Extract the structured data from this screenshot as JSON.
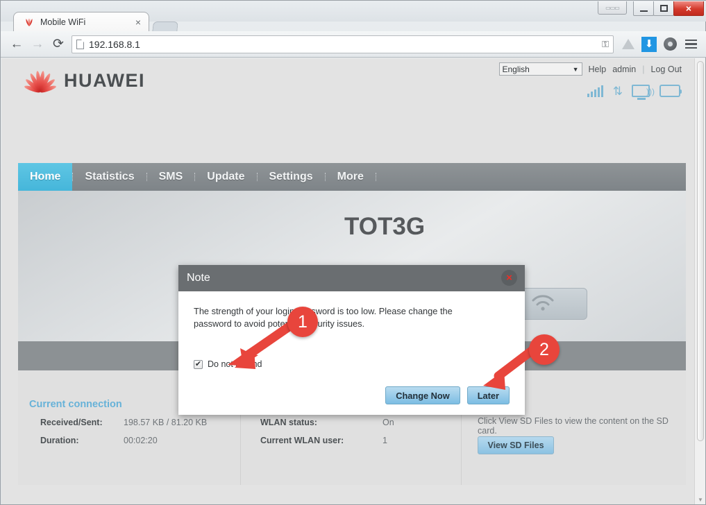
{
  "browser": {
    "window_controls": {
      "restore_tabs": "restore-tabs-icon",
      "minimize": "minimize-icon",
      "maximize": "maximize-icon",
      "close": "×"
    },
    "tab": {
      "title": "Mobile WiFi",
      "favicon": "huawei-favicon",
      "close": "×"
    },
    "toolbar": {
      "back": "←",
      "forward": "→",
      "reload": "⟳",
      "url": "192.168.8.1",
      "omnibox_key_icon": "key-icon",
      "extensions": [
        "drive-icon",
        "download-icon",
        "film-reel-icon"
      ],
      "menu": "hamburger-menu-icon"
    },
    "scrollbar": {
      "down_arrow": "▼"
    }
  },
  "header": {
    "brand": "HUAWEI",
    "language": {
      "value": "English",
      "caret": "▼"
    },
    "links": {
      "help": "Help",
      "user": "admin",
      "separator": "|",
      "logout": "Log Out"
    },
    "status_icons": [
      "signal-bars-icon",
      "data-transfer-icon",
      "wlan-device-icon",
      "battery-icon"
    ],
    "arrows_glyph": "⇅"
  },
  "nav": {
    "items": [
      {
        "label": "Home",
        "active": true
      },
      {
        "label": "Statistics",
        "active": false
      },
      {
        "label": "SMS",
        "active": false
      },
      {
        "label": "Update",
        "active": false
      },
      {
        "label": "Settings",
        "active": false
      },
      {
        "label": "More",
        "active": false
      }
    ]
  },
  "banner": {
    "network_name": "TOT3G",
    "signal_bars": [
      20,
      42,
      60,
      80
    ],
    "wifi_glyph": "≋"
  },
  "info": {
    "current_connection": {
      "title": "Current connection",
      "rows": [
        {
          "label": "Received/Sent:",
          "value": "198.57 KB / 81.20 KB"
        },
        {
          "label": "Duration:",
          "value": "00:02:20"
        }
      ]
    },
    "wlan": {
      "rows": [
        {
          "label": "WLAN status:",
          "value": "On"
        },
        {
          "label": "Current WLAN user:",
          "value": "1"
        }
      ]
    },
    "sd_card": {
      "hint": "Click View SD Files to view the content on the SD card.",
      "button": "View SD Files"
    }
  },
  "dialog": {
    "title": "Note",
    "close": "×",
    "message": "The strength of your login password is too low. Please change the password to avoid potential security issues.",
    "checkbox": {
      "label": "Do not remind",
      "checked": true,
      "glyph": "✔"
    },
    "buttons": {
      "primary": "Change Now",
      "secondary": "Later"
    }
  },
  "annotations": [
    {
      "number": "1",
      "points_to": "do-not-remind-checkbox"
    },
    {
      "number": "2",
      "points_to": "later-button"
    }
  ],
  "colors": {
    "accent_blue": "#45b6da",
    "nav_gray": "#8f9497",
    "annotation_red": "#e8453c",
    "huawei_red": "#c62423",
    "link_blue": "#67b2d8"
  }
}
